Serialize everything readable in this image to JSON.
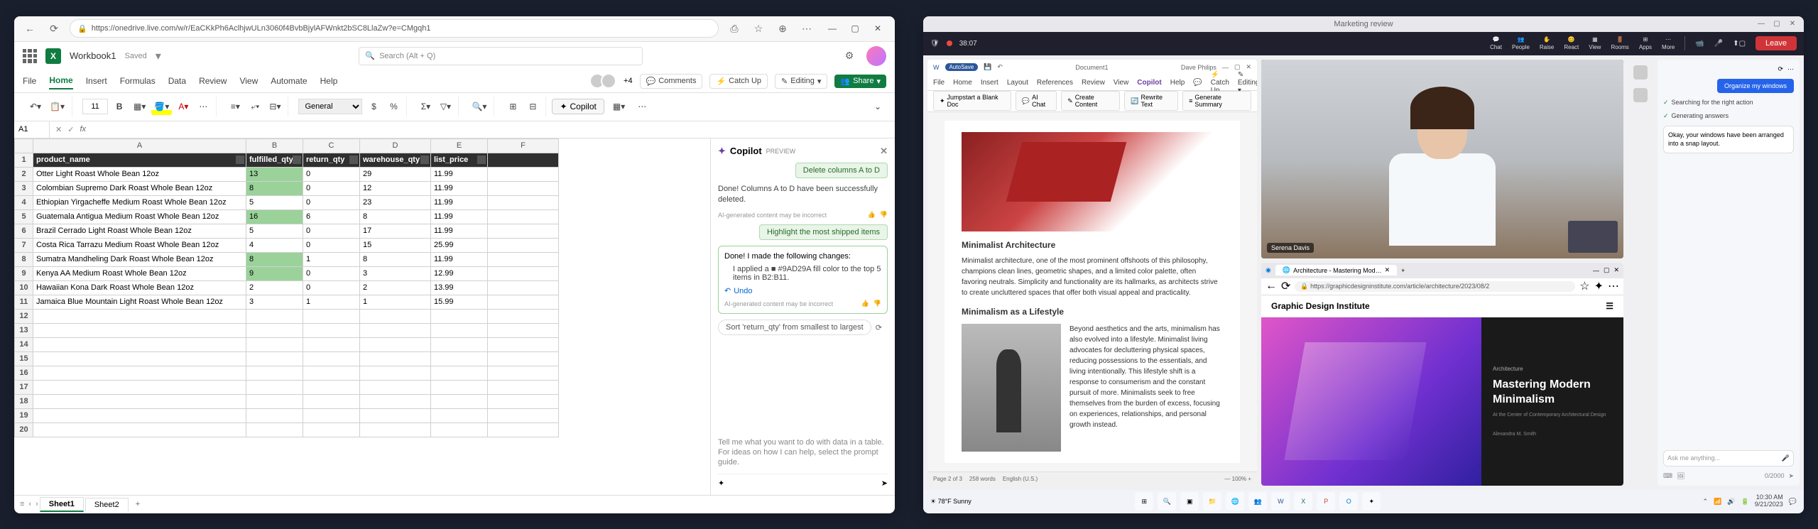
{
  "excel": {
    "url": "https://onedrive.live.com/w/r/EaCKkPh6AclhjwULn3060f4BvbBjylAFWnkt2bSC8LlaZw?e=CMgqh1",
    "app_name": "X",
    "doc_name": "Workbook1",
    "saved_status": "Saved",
    "search_placeholder": "Search (Alt + Q)",
    "tabs": [
      "File",
      "Home",
      "Insert",
      "Formulas",
      "Data",
      "Review",
      "View",
      "Automate",
      "Help"
    ],
    "active_tab": "Home",
    "presence_more": "+4",
    "comments_label": "Comments",
    "catchup_label": "Catch Up",
    "editing_label": "Editing",
    "share_label": "Share",
    "font_size": "11",
    "bold": "B",
    "number_format": "General",
    "copilot_label": "Copilot",
    "name_box": "A1",
    "fx": "fx",
    "columns": [
      "A",
      "B",
      "C",
      "D",
      "E",
      "F"
    ],
    "headers": [
      "product_name",
      "fulfilled_qty",
      "return_qty",
      "warehouse_qty",
      "list_price",
      ""
    ],
    "rows": [
      {
        "n": 1,
        "c": [
          "Otter Light Roast Whole Bean 12oz",
          "13",
          "0",
          "29",
          "11.99",
          ""
        ],
        "hl": true
      },
      {
        "n": 2,
        "c": [
          "Colombian Supremo Dark Roast Whole Bean 12oz",
          "8",
          "0",
          "12",
          "11.99",
          ""
        ],
        "hl": true
      },
      {
        "n": 3,
        "c": [
          "Ethiopian Yirgacheffe Medium Roast Whole Bean 12oz",
          "5",
          "0",
          "23",
          "11.99",
          ""
        ],
        "hl": false
      },
      {
        "n": 4,
        "c": [
          "Guatemala Antigua Medium Roast Whole Bean 12oz",
          "16",
          "6",
          "8",
          "11.99",
          ""
        ],
        "hl": true
      },
      {
        "n": 5,
        "c": [
          "Brazil Cerrado Light Roast Whole Bean 12oz",
          "5",
          "0",
          "17",
          "11.99",
          ""
        ],
        "hl": false
      },
      {
        "n": 6,
        "c": [
          "Costa Rica Tarrazu Medium Roast Whole Bean 12oz",
          "4",
          "0",
          "15",
          "25.99",
          ""
        ],
        "hl": false
      },
      {
        "n": 7,
        "c": [
          "Sumatra Mandheling Dark Roast Whole Bean 12oz",
          "8",
          "1",
          "8",
          "11.99",
          ""
        ],
        "hl": true
      },
      {
        "n": 8,
        "c": [
          "Kenya AA Medium Roast Whole Bean 12oz",
          "9",
          "0",
          "3",
          "12.99",
          ""
        ],
        "hl": true
      },
      {
        "n": 9,
        "c": [
          "Hawaiian Kona Dark Roast Whole Bean 12oz",
          "2",
          "0",
          "2",
          "13.99",
          ""
        ],
        "hl": false
      },
      {
        "n": 10,
        "c": [
          "Jamaica Blue Mountain Light Roast Whole Bean 12oz",
          "3",
          "1",
          "1",
          "15.99",
          ""
        ],
        "hl": false
      }
    ],
    "empty_rows": [
      11,
      12,
      13,
      14,
      15,
      16,
      17,
      18,
      19
    ],
    "sheets": [
      "Sheet1",
      "Sheet2"
    ],
    "active_sheet": "Sheet1",
    "copilot": {
      "title": "Copilot",
      "preview": "PREVIEW",
      "chip1": "Delete columns A to D",
      "msg1": "Done! Columns A to D have been successfully deleted.",
      "note": "AI-generated content may be incorrect",
      "chip2": "Highlight the most shipped items",
      "card_title": "Done! I made the following changes:",
      "bullet": "I applied a ■ #9AD29A fill color to the top 5 items in B2:B11.",
      "undo": "Undo",
      "suggest": "Sort 'return_qty' from smallest to largest",
      "hint": "Tell me what you want to do with data in a table. For ideas on how I can help, select the prompt guide."
    }
  },
  "teams": {
    "title": "Marketing review",
    "timer": "38:07",
    "leave": "Leave",
    "icons": [
      "Chat",
      "People",
      "Raise",
      "React",
      "View",
      "Rooms",
      "Apps",
      "More"
    ],
    "word": {
      "autosave": "AutoSave",
      "doc": "Document1",
      "user": "Dave Philips",
      "tabs": [
        "File",
        "Home",
        "Insert",
        "Layout",
        "References",
        "Review",
        "View",
        "Copilot",
        "Help"
      ],
      "toolbar": [
        "Jumpstart a Blank Doc",
        "AI Chat",
        "Create Content",
        "Rewrite Text",
        "Generate Summary"
      ],
      "catchup": "Catch Up",
      "editing": "Editing",
      "h1": "Minimalist Architecture",
      "p1": "Minimalist architecture, one of the most prominent offshoots of this philosophy, champions clean lines, geometric shapes, and a limited color palette, often favoring neutrals. Simplicity and functionality are its hallmarks, as architects strive to create uncluttered spaces that offer both visual appeal and practicality.",
      "h2": "Minimalism as a Lifestyle",
      "p2": "Beyond aesthetics and the arts, minimalism has also evolved into a lifestyle. Minimalist living advocates for decluttering physical spaces, reducing possessions to the essentials, and living intentionally. This lifestyle shift is a response to consumerism and the constant pursuit of more. Minimalists seek to free themselves from the burden of excess, focusing on experiences, relationships, and personal growth instead.",
      "status_page": "Page 2 of 3",
      "status_words": "258 words",
      "status_lang": "English (U.S.)"
    },
    "video": {
      "name": "Serena Davis"
    },
    "edge": {
      "tab": "Architecture - Mastering Mod…",
      "url": "https://graphicdesigninstitute.com/article/architecture/2023/08/2",
      "brand": "Graphic Design Institute",
      "category": "Architecture",
      "headline": "Mastering Modern Minimalism",
      "subtitle": "At the Center of Contemporary Architectural Design",
      "author": "Alexandra M. Smith"
    },
    "copilot": {
      "action": "Organize my windows",
      "check1": "Searching for the right action",
      "check2": "Generating answers",
      "reply": "Okay, your windows have been arranged into a snap layout.",
      "input_ph": "Ask me anything...",
      "counter": "0/2000"
    },
    "clock": {
      "time": "10:30 AM",
      "date": "9/21/2023"
    }
  }
}
